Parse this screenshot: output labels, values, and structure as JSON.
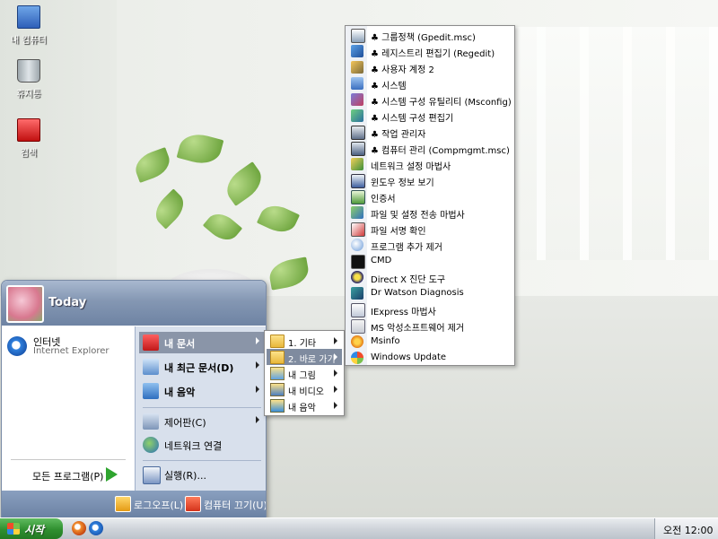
{
  "desktop": {
    "icons": [
      {
        "label": "내 컴퓨터",
        "icon": "computer-icon"
      },
      {
        "label": "휴지통",
        "icon": "recycle-bin-icon"
      },
      {
        "label": "검색",
        "icon": "search-icon"
      }
    ]
  },
  "start_menu": {
    "user_name": "Today",
    "pinned": {
      "title": "인터넷",
      "subtitle": "Internet Explorer",
      "icon": "internet-explorer-icon"
    },
    "all_programs_label": "모든 프로그램(P)",
    "right_items": [
      {
        "label": "내 문서",
        "icon": "my-documents-icon",
        "has_submenu": true,
        "selected": true
      },
      {
        "label": "내 최근 문서(D)",
        "icon": "recent-documents-icon",
        "has_submenu": true,
        "selected": false
      },
      {
        "label": "내 음악",
        "icon": "my-music-icon",
        "has_submenu": true,
        "selected": false
      },
      {
        "label": "제어판(C)",
        "icon": "control-panel-icon",
        "has_submenu": true,
        "selected": false
      },
      {
        "label": "네트워크 연결",
        "icon": "network-connections-icon",
        "has_submenu": false,
        "selected": false
      },
      {
        "label": "실행(R)...",
        "icon": "run-icon",
        "has_submenu": false,
        "selected": false
      }
    ],
    "footer": {
      "logoff_label": "로그오프(L)",
      "shutdown_label": "컴퓨터 끄기(U)"
    }
  },
  "documents_submenu": [
    {
      "label": "1. 기타",
      "icon": "folder-icon",
      "has_submenu": true,
      "selected": false
    },
    {
      "label": "2. 바로 가기",
      "icon": "folder-icon",
      "has_submenu": true,
      "selected": true
    },
    {
      "label": "내 그림",
      "icon": "my-pictures-icon",
      "has_submenu": true,
      "selected": false
    },
    {
      "label": "내 비디오",
      "icon": "my-videos-icon",
      "has_submenu": true,
      "selected": false
    },
    {
      "label": "내 음악",
      "icon": "my-music-icon",
      "has_submenu": true,
      "selected": false
    }
  ],
  "shortcuts_submenu": [
    {
      "label": "♣ 그룹정책 (Gpedit.msc)",
      "icon": "group-policy-icon"
    },
    {
      "label": "♣ 레지스트리 편집기 (Regedit)",
      "icon": "registry-editor-icon"
    },
    {
      "label": "♣ 사용자 계정 2",
      "icon": "user-accounts-icon"
    },
    {
      "label": "♣ 시스템",
      "icon": "system-icon"
    },
    {
      "label": "♣ 시스템 구성 유틸리티 (Msconfig)",
      "icon": "system-config-icon"
    },
    {
      "label": "♣ 시스템 구성 편집기",
      "icon": "sysedit-icon"
    },
    {
      "label": "♣ 작업 관리자",
      "icon": "task-manager-icon"
    },
    {
      "label": "♣ 컴퓨터 관리 (Compmgmt.msc)",
      "icon": "computer-management-icon"
    },
    {
      "label": "네트워크 설정 마법사",
      "icon": "network-wizard-icon"
    },
    {
      "label": "윈도우 정보 보기",
      "icon": "windows-info-icon"
    },
    {
      "label": "인증서",
      "icon": "certificate-icon"
    },
    {
      "label": "파일 및 설정 전송 마법사",
      "icon": "transfer-wizard-icon"
    },
    {
      "label": "파일 서명 확인",
      "icon": "file-signature-icon"
    },
    {
      "label": "프로그램 추가 제거",
      "icon": "add-remove-programs-icon"
    },
    {
      "label": "CMD",
      "icon": "cmd-icon"
    },
    {
      "label": "Direct X 진단 도구",
      "icon": "directx-icon"
    },
    {
      "label": "Dr Watson Diagnosis",
      "icon": "dr-watson-icon"
    },
    {
      "label": "IExpress 마법사",
      "icon": "iexpress-icon"
    },
    {
      "label": "MS 악성소프트웨어 제거",
      "icon": "malware-removal-icon"
    },
    {
      "label": "Msinfo",
      "icon": "msinfo-icon"
    },
    {
      "label": "Windows Update",
      "icon": "windows-update-icon"
    }
  ],
  "taskbar": {
    "start_label": "시작",
    "quicklaunch": [
      {
        "icon": "media-player-icon"
      },
      {
        "icon": "internet-explorer-icon"
      }
    ],
    "clock": "오전 12:00"
  }
}
